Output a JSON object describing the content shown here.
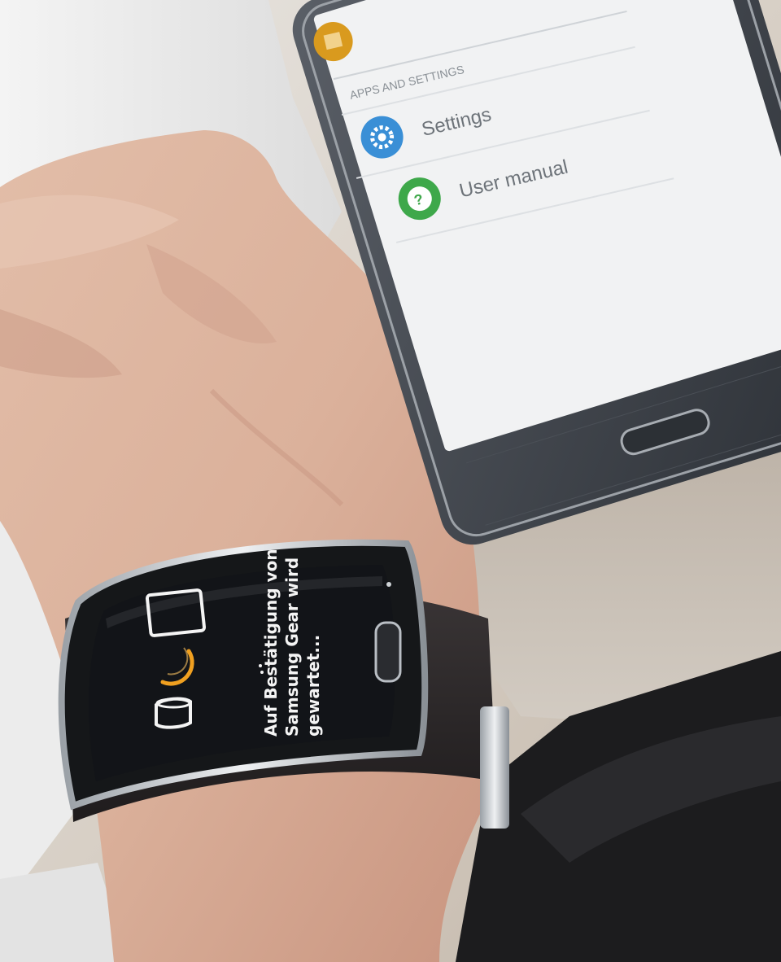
{
  "phone": {
    "section_header": "APPS AND SETTINGS",
    "items": [
      {
        "label": "Settings",
        "icon": "gear-icon",
        "icon_color": "#3a8fd6"
      },
      {
        "label": "User manual",
        "icon": "question-icon",
        "icon_color": "#3ea84a"
      }
    ],
    "top_icon_color": "#d99a1e",
    "screen_color": "#f1f2f3",
    "body_color": "#3c4047"
  },
  "watch": {
    "message_lines": [
      "Auf Bestätigung von",
      "Samsung Gear wird",
      "gewartet..."
    ],
    "icons": [
      "phone-outline-icon",
      "loading-arc-icon",
      "watch-outline-icon"
    ],
    "spinner_color": "#f0a020",
    "screen_color": "#121418"
  }
}
